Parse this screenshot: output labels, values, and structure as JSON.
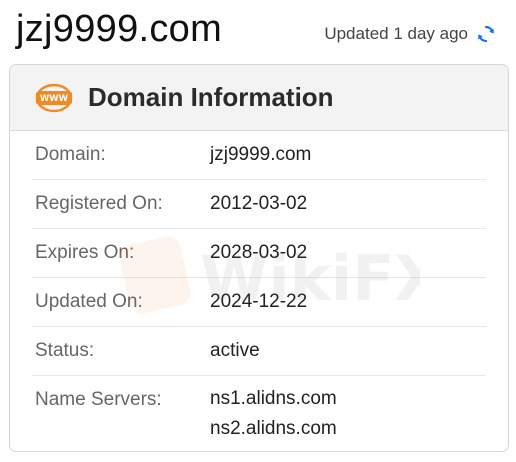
{
  "header": {
    "domain": "jzj9999.com",
    "updated_text": "Updated 1 day ago",
    "refresh_icon": "refresh-icon"
  },
  "card": {
    "icon": "www-icon",
    "title": "Domain Information",
    "rows": [
      {
        "label": "Domain:",
        "value": "jzj9999.com"
      },
      {
        "label": "Registered On:",
        "value": "2012-03-02"
      },
      {
        "label": "Expires On:",
        "value": "2028-03-02"
      },
      {
        "label": "Updated On:",
        "value": "2024-12-22"
      },
      {
        "label": "Status:",
        "value": "active"
      }
    ],
    "name_servers": {
      "label": "Name Servers:",
      "values": [
        "ns1.alidns.com",
        "ns2.alidns.com"
      ]
    }
  },
  "watermark": {
    "text": "WikiFX",
    "icon": "wikifx-logo-icon"
  },
  "colors": {
    "accent_blue": "#1a73e8",
    "icon_orange": "#f08a24",
    "header_bg": "#f3f3f3"
  }
}
